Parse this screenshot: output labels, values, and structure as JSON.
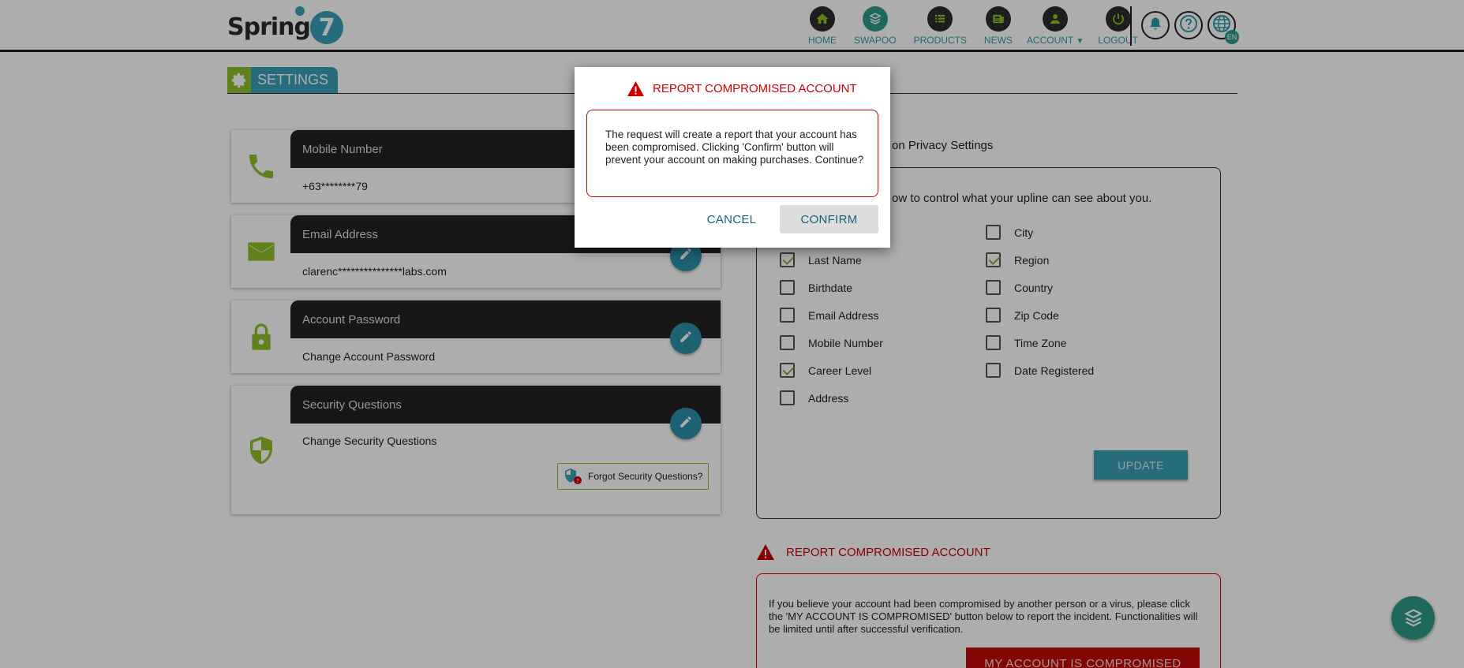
{
  "brand": {
    "name": "Spring",
    "number": "7"
  },
  "nav": {
    "items": [
      {
        "label": "HOME",
        "icon": "home-icon"
      },
      {
        "label": "SWAPOO",
        "icon": "swapoo-icon"
      },
      {
        "label": "PRODUCTS",
        "icon": "products-icon"
      },
      {
        "label": "NEWS",
        "icon": "news-icon"
      },
      {
        "label": "ACCOUNT",
        "icon": "account-icon"
      },
      {
        "label": "LOGOUT",
        "icon": "power-icon"
      }
    ],
    "language_badge": "EN"
  },
  "settings": {
    "tab_label": "SETTINGS"
  },
  "cards": {
    "mobile": {
      "title": "Mobile Number",
      "value": "+63********79"
    },
    "email": {
      "title": "Email Address",
      "value": "clarenc***************labs.com"
    },
    "password": {
      "title": "Account Password",
      "value": "Change Account Password"
    },
    "security": {
      "title": "Security Questions",
      "value": "Change Security Questions",
      "forgot_label": "Forgot Security Questions?"
    }
  },
  "privacy": {
    "title": "on Privacy Settings",
    "description": "ow to control what your upline can see about you.",
    "left_options": [
      {
        "label": "Last Name",
        "checked": true
      },
      {
        "label": "Birthdate",
        "checked": false
      },
      {
        "label": "Email Address",
        "checked": false
      },
      {
        "label": "Mobile Number",
        "checked": false
      },
      {
        "label": "Career Level",
        "checked": true
      },
      {
        "label": "Address",
        "checked": false
      }
    ],
    "right_options": [
      {
        "label": "City",
        "checked": false
      },
      {
        "label": "Region",
        "checked": true
      },
      {
        "label": "Country",
        "checked": false
      },
      {
        "label": "Zip Code",
        "checked": false
      },
      {
        "label": "Time Zone",
        "checked": false
      },
      {
        "label": "Date Registered",
        "checked": false
      }
    ],
    "update_label": "UPDATE"
  },
  "report": {
    "title": "REPORT COMPROMISED ACCOUNT",
    "text": "If you believe your account had been compromised by another person or a virus, please click the 'MY ACCOUNT IS COMPROMISED' button below to report the incident. Functionalities will be limited until after successful verification.",
    "button_label": "MY ACCOUNT IS COMPROMISED"
  },
  "modal": {
    "title": "REPORT COMPROMISED ACCOUNT",
    "text": "The request will create a report that your account has been compromised. Clicking 'Confirm' button will prevent your account on making purchases. Continue?",
    "cancel_label": "CANCEL",
    "confirm_label": "CONFIRM"
  },
  "colors": {
    "accent": "#3aa0b4",
    "green": "#8fbf2a",
    "danger": "#c00000",
    "dark": "#232323"
  }
}
